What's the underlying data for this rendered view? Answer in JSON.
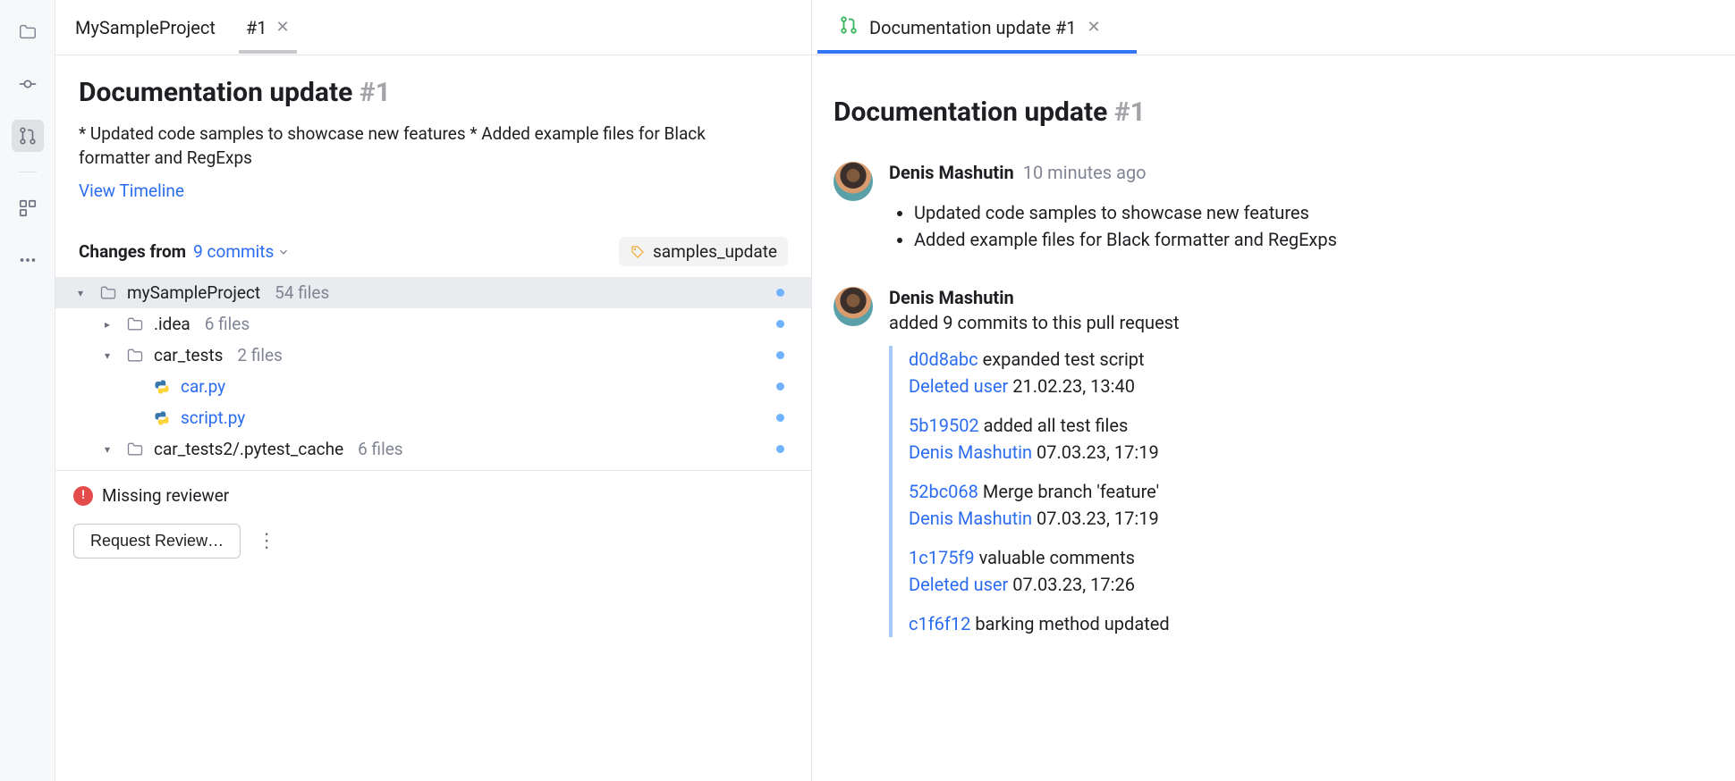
{
  "rail": {
    "items": [
      {
        "name": "folder-icon"
      },
      {
        "name": "commit-icon"
      },
      {
        "name": "pull-request-icon"
      },
      {
        "name": "apps-icon"
      },
      {
        "name": "more-icon"
      }
    ]
  },
  "tabs": {
    "crumb": "MySampleProject",
    "active": "#1"
  },
  "pr": {
    "title": "Documentation update ",
    "number": "#1",
    "description": "* Updated code samples to showcase new features * Added example files for Black formatter and RegExps",
    "view_timeline": "View Timeline"
  },
  "changes": {
    "label": "Changes from",
    "commits_label": "9 commits",
    "branch": "samples_update"
  },
  "tree": [
    {
      "indent": 0,
      "chev": "down",
      "icon": "folder",
      "name": "mySampleProject",
      "count": "54 files",
      "sel": true,
      "dot": true
    },
    {
      "indent": 1,
      "chev": "right",
      "icon": "folder",
      "name": ".idea",
      "count": "6 files",
      "dot": true
    },
    {
      "indent": 1,
      "chev": "down",
      "icon": "folder",
      "name": "car_tests",
      "count": "2 files",
      "dot": true
    },
    {
      "indent": 2,
      "chev": "none",
      "icon": "python",
      "name": "car.py",
      "link": true,
      "dot": true
    },
    {
      "indent": 2,
      "chev": "none",
      "icon": "python",
      "name": "script.py",
      "link": true,
      "dot": true
    },
    {
      "indent": 1,
      "chev": "down",
      "icon": "folder",
      "name": "car_tests2/.pytest_cache",
      "count": "6 files",
      "dot": true
    }
  ],
  "footer": {
    "warning": "Missing reviewer",
    "request_button": "Request Review…"
  },
  "right_tab": {
    "label": "Documentation update #1"
  },
  "timeline": {
    "title": "Documentation update ",
    "number": "#1",
    "items": [
      {
        "author": "Denis Mashutin",
        "time": "10 minutes ago",
        "bullets": [
          "Updated code samples to showcase new features",
          "Added example files for Black formatter and RegExps"
        ]
      },
      {
        "author": "Denis Mashutin",
        "subdesc": "added 9 commits to this pull request",
        "commits": [
          {
            "hash": "d0d8abc",
            "msg": "expanded test script",
            "who": "Deleted user",
            "when": "21.02.23, 13:40"
          },
          {
            "hash": "5b19502",
            "msg": "added all test files",
            "who": "Denis Mashutin",
            "when": "07.03.23, 17:19"
          },
          {
            "hash": "52bc068",
            "msg": "Merge branch 'feature'",
            "who": "Denis Mashutin",
            "when": "07.03.23, 17:19"
          },
          {
            "hash": "1c175f9",
            "msg": "valuable comments",
            "who": "Deleted user",
            "when": "07.03.23, 17:26"
          },
          {
            "hash": "c1f6f12",
            "msg": "barking method updated",
            "who": "",
            "when": ""
          }
        ]
      }
    ]
  }
}
